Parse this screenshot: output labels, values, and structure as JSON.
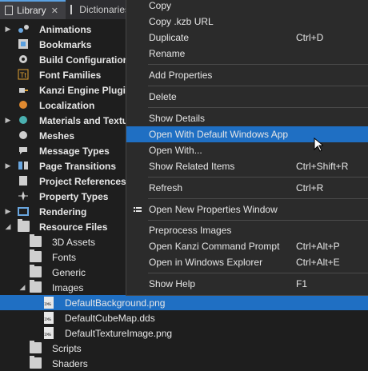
{
  "tabs": [
    {
      "label": "Library"
    },
    {
      "label": "Dictionaries"
    }
  ],
  "tree": {
    "items": [
      {
        "label": "Animations"
      },
      {
        "label": "Bookmarks"
      },
      {
        "label": "Build Configuration"
      },
      {
        "label": "Font Families"
      },
      {
        "label": "Kanzi Engine Plugins"
      },
      {
        "label": "Localization"
      },
      {
        "label": "Materials and Textures"
      },
      {
        "label": "Meshes"
      },
      {
        "label": "Message Types"
      },
      {
        "label": "Page Transitions"
      },
      {
        "label": "Project References"
      },
      {
        "label": "Property Types"
      },
      {
        "label": "Rendering"
      },
      {
        "label": "Resource Files"
      },
      {
        "label": "3D Assets"
      },
      {
        "label": "Fonts"
      },
      {
        "label": "Generic"
      },
      {
        "label": "Images"
      },
      {
        "label": "DefaultBackground.png"
      },
      {
        "label": "DefaultCubeMap.dds"
      },
      {
        "label": "DefaultTextureImage.png"
      },
      {
        "label": "Scripts"
      },
      {
        "label": "Shaders"
      }
    ]
  },
  "menu": {
    "copy": "Copy",
    "copy_kzb": "Copy .kzb URL",
    "duplicate": "Duplicate",
    "duplicate_key": "Ctrl+D",
    "rename": "Rename",
    "add_properties": "Add Properties",
    "delete": "Delete",
    "show_details": "Show Details",
    "open_default": "Open With Default Windows App",
    "open_with": "Open With...",
    "show_related": "Show Related Items",
    "show_related_key": "Ctrl+Shift+R",
    "refresh": "Refresh",
    "refresh_key": "Ctrl+R",
    "open_props_window": "Open New Properties Window",
    "preprocess": "Preprocess Images",
    "open_cmd": "Open Kanzi Command Prompt",
    "open_cmd_key": "Ctrl+Alt+P",
    "open_explorer": "Open in Windows Explorer",
    "open_explorer_key": "Ctrl+Alt+E",
    "show_help": "Show Help",
    "show_help_key": "F1"
  },
  "colors": {
    "accent": "#1f6fc3",
    "menu_bg": "#2b2b2b",
    "panel_bg": "#1e1e1e"
  }
}
